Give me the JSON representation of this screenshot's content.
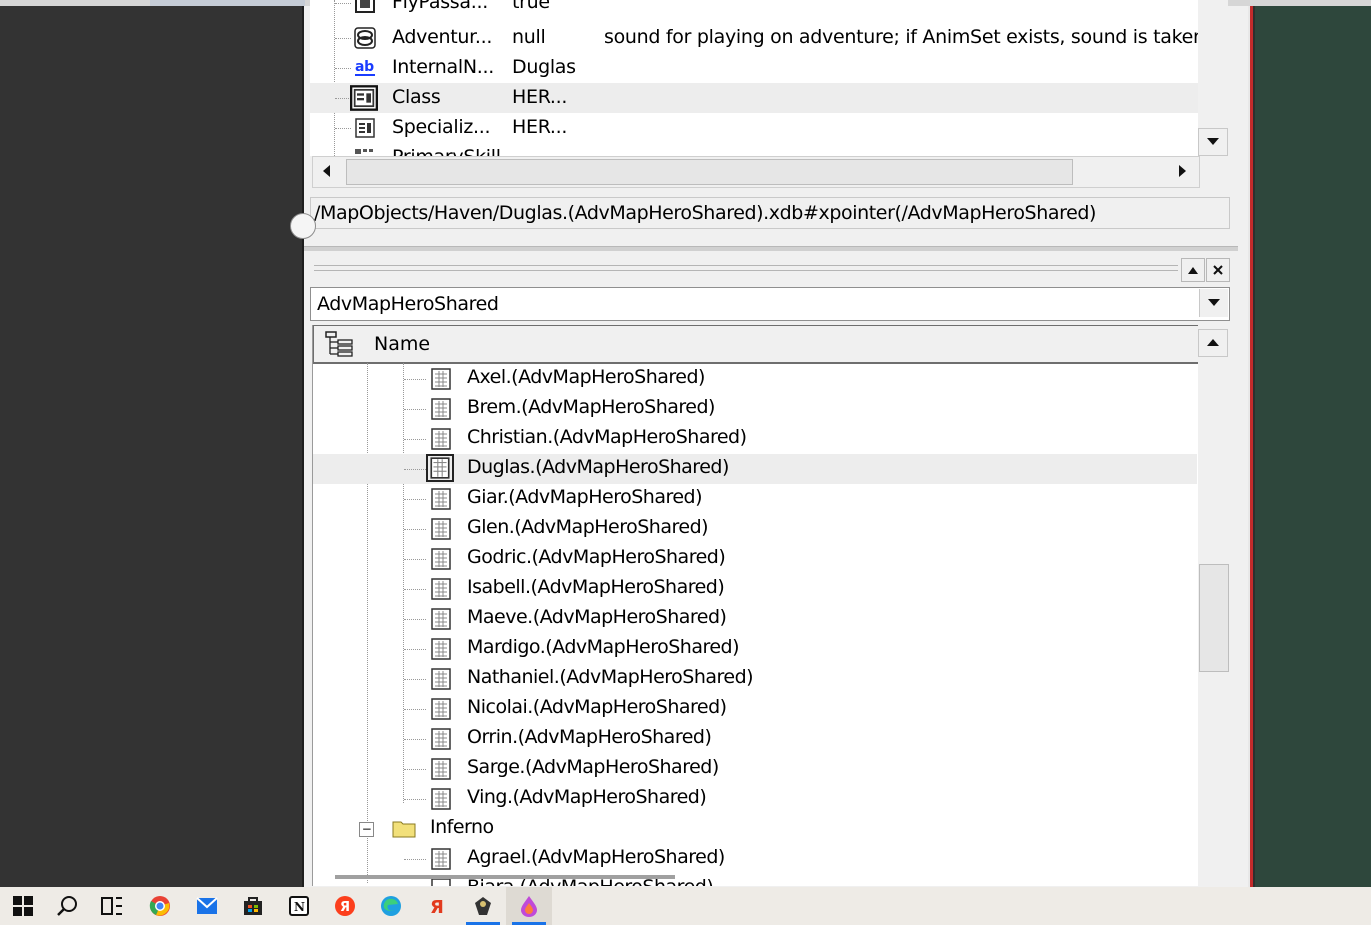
{
  "properties": {
    "rows": [
      {
        "name": "FlyPassa...",
        "value": "true",
        "desc": ""
      },
      {
        "name": "Adventur...",
        "value": "null",
        "desc": "sound for playing on adventure; if AnimSet exists, sound is taken fro"
      },
      {
        "name": "InternalN...",
        "value": "Duglas",
        "desc": ""
      },
      {
        "name": "Class",
        "value": "HER...",
        "desc": ""
      },
      {
        "name": "Specializ...",
        "value": "HER...",
        "desc": ""
      },
      {
        "name": "PrimarySkill",
        "value": "",
        "desc": ""
      }
    ],
    "selected_index": 3
  },
  "path": "/MapObjects/Haven/Duglas.(AdvMapHeroShared).xdb#xpointer(/AdvMapHeroShared)",
  "type_combo": {
    "value": "AdvMapHeroShared"
  },
  "tree": {
    "header": "Name",
    "items": [
      "Axel.(AdvMapHeroShared)",
      "Brem.(AdvMapHeroShared)",
      "Christian.(AdvMapHeroShared)",
      "Duglas.(AdvMapHeroShared)",
      "Giar.(AdvMapHeroShared)",
      "Glen.(AdvMapHeroShared)",
      "Godric.(AdvMapHeroShared)",
      "Isabell.(AdvMapHeroShared)",
      "Maeve.(AdvMapHeroShared)",
      "Mardigo.(AdvMapHeroShared)",
      "Nathaniel.(AdvMapHeroShared)",
      "Nicolai.(AdvMapHeroShared)",
      "Orrin.(AdvMapHeroShared)",
      "Sarge.(AdvMapHeroShared)",
      "Ving.(AdvMapHeroShared)"
    ],
    "selected_index": 3,
    "folder": "Inferno",
    "folder_items": [
      "Agrael.(AdvMapHeroShared)",
      "Biara.(AdvMapHeroShared)"
    ]
  },
  "taskbar": {
    "icons": [
      "windows-start-icon",
      "search-icon",
      "task-view-icon",
      "chrome-icon",
      "mail-icon",
      "store-icon",
      "notion-icon",
      "yandex-icon",
      "edge-icon",
      "yandex-browser-icon",
      "game-editor-icon",
      "paint-icon"
    ]
  }
}
